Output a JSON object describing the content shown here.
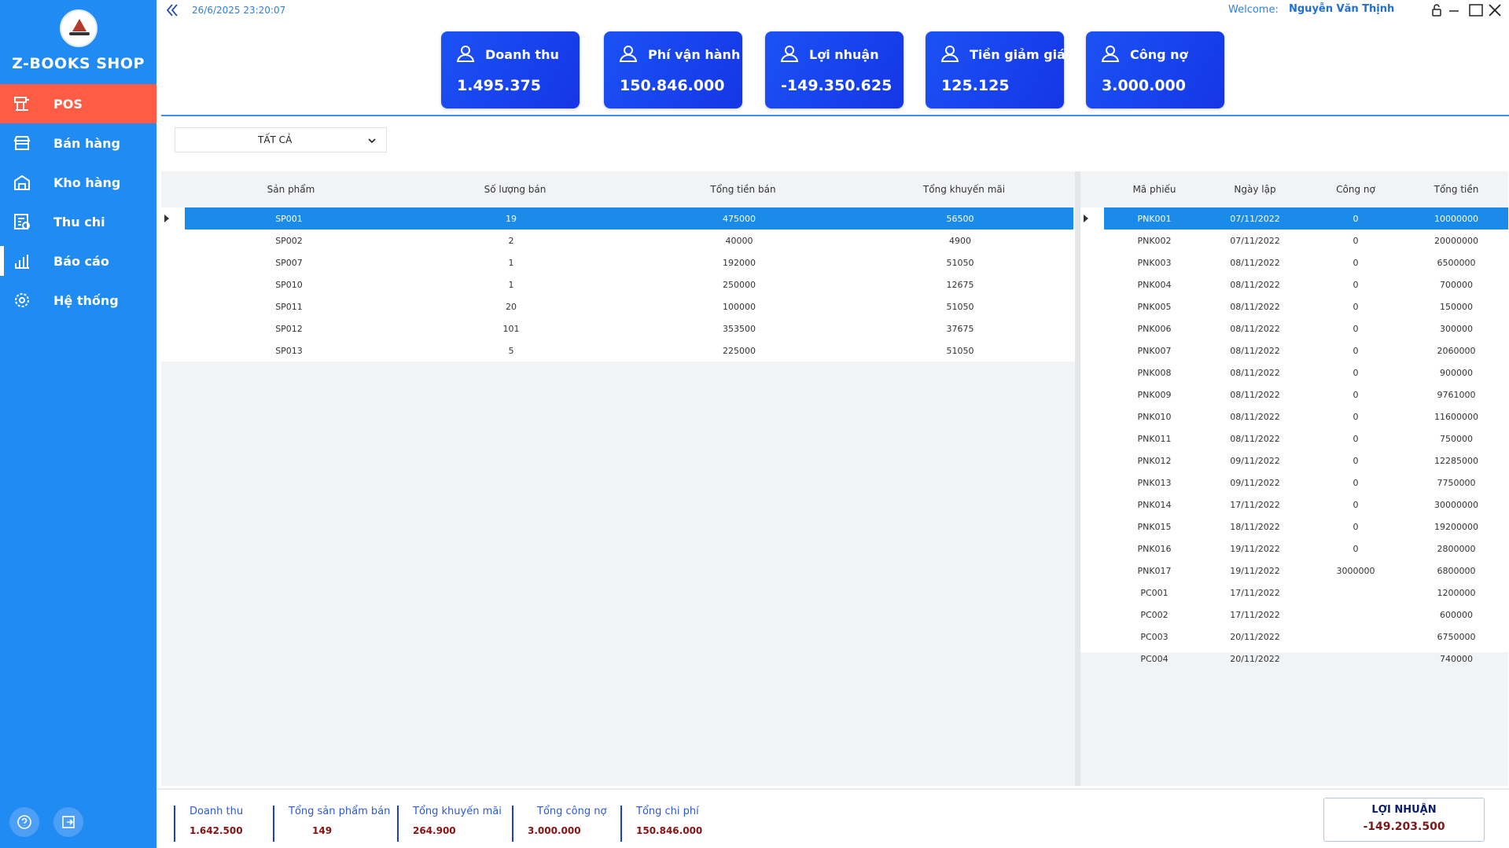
{
  "app": {
    "shop_name": "Z-BOOKS SHOP",
    "datetime": "26/6/2025 23:20:07",
    "welcome_label": "Welcome:",
    "username": "Nguyễn Văn Thịnh"
  },
  "sidebar": {
    "items": [
      {
        "label": "POS",
        "icon": "pos-icon"
      },
      {
        "label": "Bán hàng",
        "icon": "store-icon"
      },
      {
        "label": "Kho hàng",
        "icon": "warehouse-icon"
      },
      {
        "label": "Thu chi",
        "icon": "finance-icon"
      },
      {
        "label": "Báo cáo",
        "icon": "chart-icon"
      },
      {
        "label": "Hệ thống",
        "icon": "gear-icon"
      }
    ],
    "active_index": 0
  },
  "kpis": [
    {
      "label": "Doanh thu",
      "value": "1.495.375"
    },
    {
      "label": "Phí vận hành",
      "value": "150.846.000"
    },
    {
      "label": "Lợi nhuận",
      "value": "-149.350.625"
    },
    {
      "label": "Tiền giảm giá",
      "value": "125.125"
    },
    {
      "label": "Công nợ",
      "value": "3.000.000"
    }
  ],
  "filter": {
    "selected": "TẤT CẢ"
  },
  "products_table": {
    "columns": [
      "Sản phẩm",
      "Số lượng bán",
      "Tổng tiền bán",
      "Tổng khuyến mãi"
    ],
    "rows": [
      [
        "SP001",
        "19",
        "475000",
        "56500"
      ],
      [
        "SP002",
        "2",
        "40000",
        "4900"
      ],
      [
        "SP007",
        "1",
        "192000",
        "51050"
      ],
      [
        "SP010",
        "1",
        "250000",
        "12675"
      ],
      [
        "SP011",
        "20",
        "100000",
        "51050"
      ],
      [
        "SP012",
        "101",
        "353500",
        "37675"
      ],
      [
        "SP013",
        "5",
        "225000",
        "51050"
      ]
    ],
    "selected_row": 0
  },
  "receipts_table": {
    "columns": [
      "Mã phiếu",
      "Ngày lập",
      "Công nợ",
      "Tổng tiền"
    ],
    "rows": [
      [
        "PNK001",
        "07/11/2022",
        "0",
        "10000000"
      ],
      [
        "PNK002",
        "07/11/2022",
        "0",
        "20000000"
      ],
      [
        "PNK003",
        "08/11/2022",
        "0",
        "6500000"
      ],
      [
        "PNK004",
        "08/11/2022",
        "0",
        "700000"
      ],
      [
        "PNK005",
        "08/11/2022",
        "0",
        "150000"
      ],
      [
        "PNK006",
        "08/11/2022",
        "0",
        "300000"
      ],
      [
        "PNK007",
        "08/11/2022",
        "0",
        "2060000"
      ],
      [
        "PNK008",
        "08/11/2022",
        "0",
        "900000"
      ],
      [
        "PNK009",
        "08/11/2022",
        "0",
        "9761000"
      ],
      [
        "PNK010",
        "08/11/2022",
        "0",
        "11600000"
      ],
      [
        "PNK011",
        "08/11/2022",
        "0",
        "750000"
      ],
      [
        "PNK012",
        "09/11/2022",
        "0",
        "12285000"
      ],
      [
        "PNK013",
        "09/11/2022",
        "0",
        "7750000"
      ],
      [
        "PNK014",
        "17/11/2022",
        "0",
        "30000000"
      ],
      [
        "PNK015",
        "18/11/2022",
        "0",
        "19200000"
      ],
      [
        "PNK016",
        "19/11/2022",
        "0",
        "2800000"
      ],
      [
        "PNK017",
        "19/11/2022",
        "3000000",
        "6800000"
      ],
      [
        "PC001",
        "17/11/2022",
        "",
        "1200000"
      ],
      [
        "PC002",
        "17/11/2022",
        "",
        "600000"
      ],
      [
        "PC003",
        "20/11/2022",
        "",
        "6750000"
      ],
      [
        "PC004",
        "20/11/2022",
        "",
        "740000"
      ]
    ],
    "selected_row": 0
  },
  "summary": [
    {
      "label": "Doanh thu",
      "value": "1.642.500"
    },
    {
      "label": "Tổng sản phẩm bán",
      "value": "149"
    },
    {
      "label": "Tổng khuyến mãi",
      "value": "264.900"
    },
    {
      "label": "Tổng công nợ",
      "value": "3.000.000"
    },
    {
      "label": "Tổng chi phí",
      "value": "150.846.000"
    }
  ],
  "profit": {
    "label": "LỢI NHUẬN",
    "value": "-149.203.500"
  },
  "colors": {
    "sidebar": "#1f8bf3",
    "active_nav": "#ff5c45",
    "kpi_card": "#1b52f5",
    "row_selected": "#1a8be9"
  }
}
